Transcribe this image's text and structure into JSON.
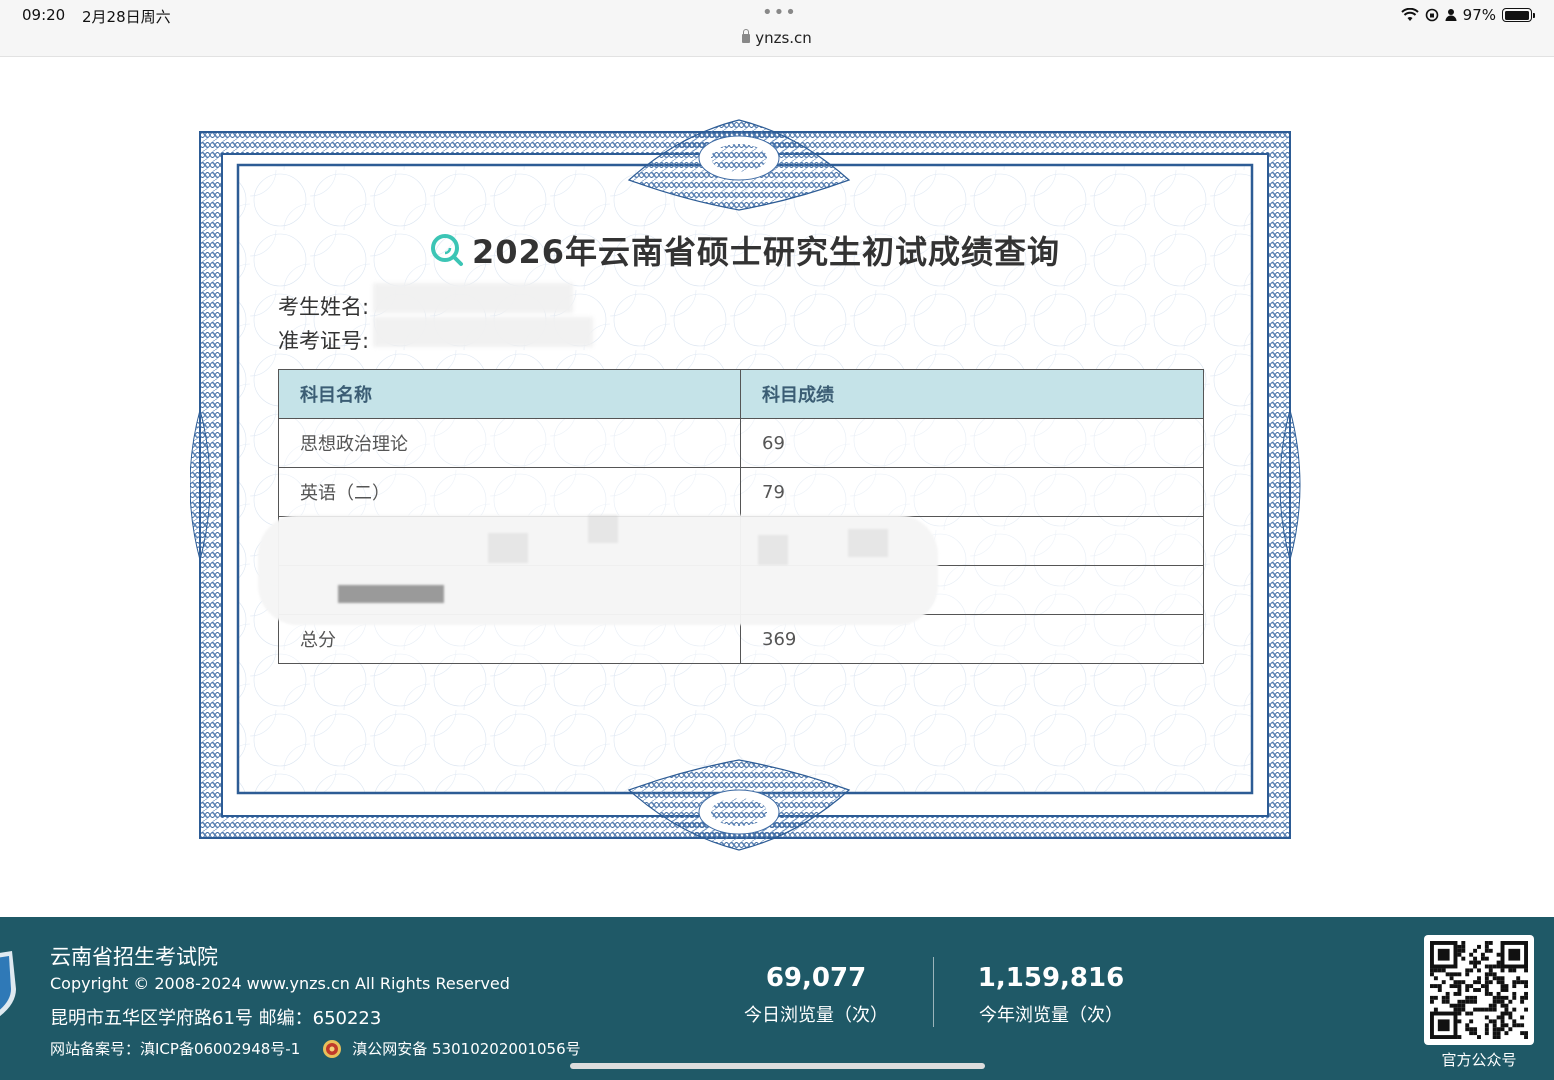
{
  "status_bar": {
    "time": "09:20",
    "date": "2月28日周六",
    "dots": "•••",
    "url": "ynzs.cn",
    "battery": "97%",
    "battery_level": 0.97
  },
  "certificate": {
    "title": "2026年云南省硕士研究生初试成绩查询",
    "name_label": "考生姓名:",
    "number_label": "准考证号:",
    "table": {
      "headers": [
        "科目名称",
        "科目成绩"
      ],
      "rows": [
        [
          "思想政治理论",
          "69"
        ],
        [
          "英语（二）",
          "79"
        ],
        [
          "",
          ""
        ],
        [
          "",
          ""
        ],
        [
          "总分",
          "369"
        ]
      ]
    }
  },
  "footer": {
    "org_name": "云南省招生考试院",
    "copyright": "Copyright © 2008-2024 www.ynzs.cn All Rights Reserved",
    "address": "昆明市五华区学府路61号 邮编：650223",
    "icp": "网站备案号：滇ICP备06002948号-1",
    "police": "滇公网安备 53010202001056号",
    "stats": {
      "today_value": "69,077",
      "today_label": "今日浏览量（次）",
      "year_value": "1,159,816",
      "year_label": "今年浏览量（次）"
    },
    "qr_label": "官方公众号"
  },
  "colors": {
    "frame_blue": "#2d5c95",
    "header_teal": "#c5e3e8",
    "footer_bg": "#1f5967",
    "title_icon": "#3cc5b5"
  }
}
